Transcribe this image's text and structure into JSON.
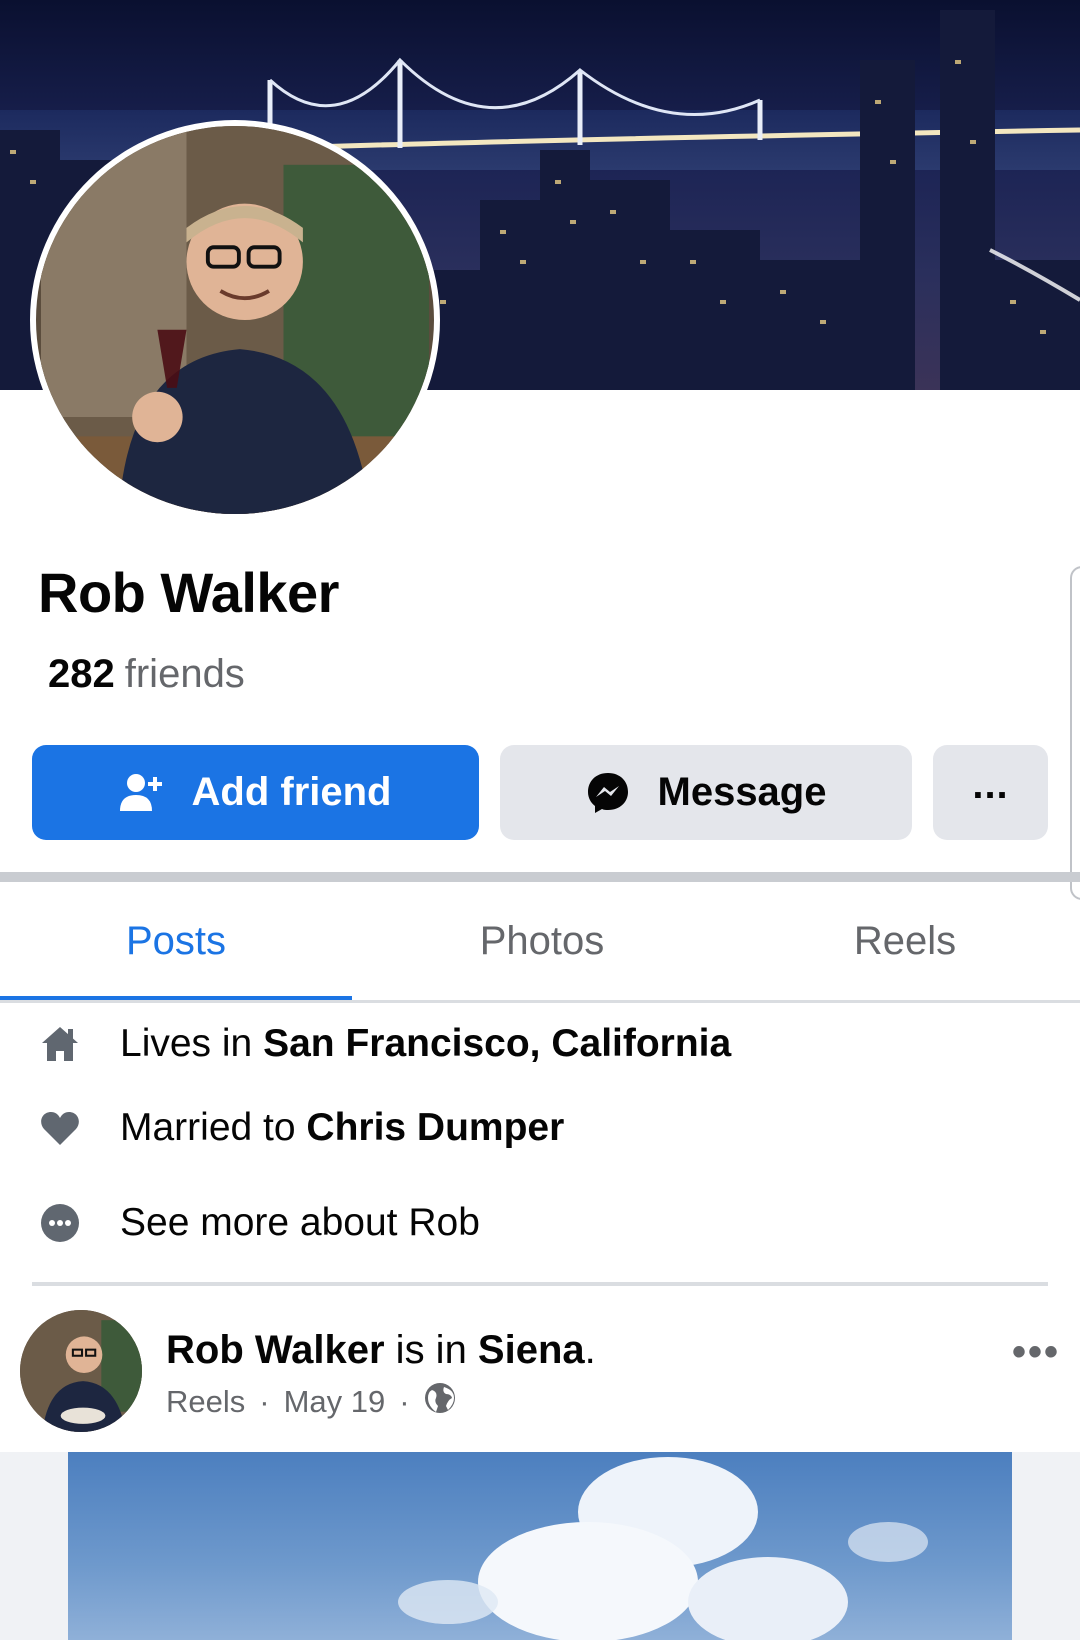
{
  "profile": {
    "name": "Rob Walker",
    "friends_count": "282",
    "friends_label": "friends"
  },
  "actions": {
    "add_friend": "Add friend",
    "message": "Message",
    "more": "..."
  },
  "tabs": [
    {
      "label": "Posts",
      "active": true
    },
    {
      "label": "Photos",
      "active": false
    },
    {
      "label": "Reels",
      "active": false
    }
  ],
  "intro": {
    "lives_prefix": "Lives in ",
    "lives_place": "San Francisco, California",
    "married_prefix": "Married to ",
    "married_to": "Chris Dumper",
    "see_more": "See more about Rob"
  },
  "post": {
    "author": "Rob Walker",
    "is_in": " is in ",
    "place": "Siena",
    "period": ".",
    "source": "Reels",
    "dot": "·",
    "date": "May 19",
    "more": "•••"
  },
  "colors": {
    "accent": "#1b74e4",
    "button_gray": "#e4e6eb",
    "secondary_text": "#65676b"
  },
  "icons": {
    "add_friend": "person-plus-icon",
    "message": "messenger-icon",
    "home": "home-icon",
    "heart": "heart-icon",
    "more": "more-circle-icon",
    "audience": "globe-icon"
  }
}
